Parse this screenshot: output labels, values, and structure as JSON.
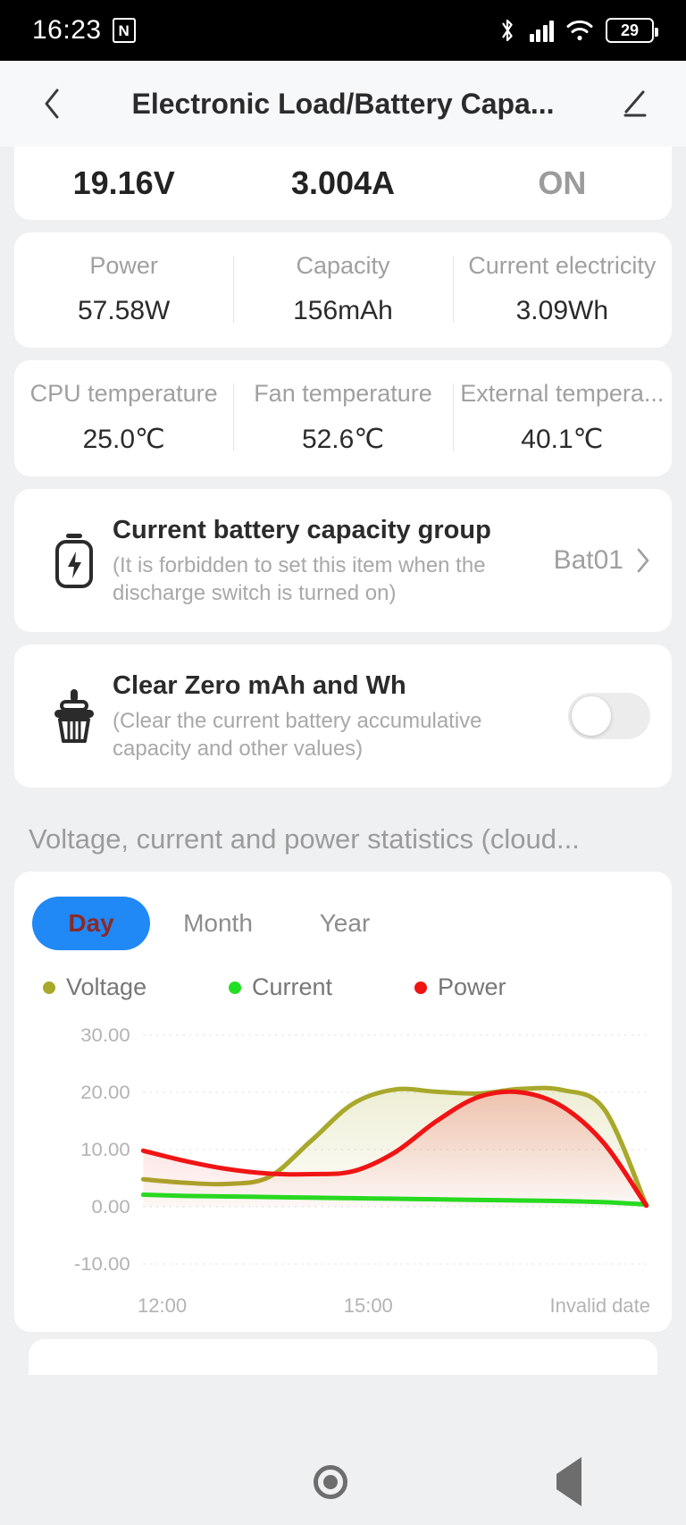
{
  "status_bar": {
    "time": "16:23",
    "nfc_glyph": "N",
    "battery_percent": "29",
    "icons": [
      "nfc-icon",
      "bluetooth-icon",
      "cellular-signal-icon",
      "wifi-icon",
      "battery-icon"
    ]
  },
  "app_bar": {
    "title": "Electronic Load/Battery Capa...",
    "back_icon": "chevron-left-icon",
    "edit_icon": "pencil-icon"
  },
  "readout": {
    "voltage": "19.16V",
    "current": "3.004A",
    "state": "ON"
  },
  "metrics_primary": [
    {
      "label": "Power",
      "value": "57.58W"
    },
    {
      "label": "Capacity",
      "value": "156mAh"
    },
    {
      "label": "Current electricity",
      "value": "3.09Wh"
    }
  ],
  "metrics_temperature": [
    {
      "label": "CPU temperature",
      "value": "25.0℃"
    },
    {
      "label": "Fan temperature",
      "value": "52.6℃"
    },
    {
      "label": "External tempera...",
      "value": "40.1℃"
    }
  ],
  "battery_group_setting": {
    "icon": "battery-bolt-icon",
    "title": "Current battery capacity group",
    "hint": "(It is forbidden to set this item when the discharge switch is turned on)",
    "value": "Bat01",
    "chevron": "chevron-right-icon"
  },
  "clear_zero_setting": {
    "icon": "broom-icon",
    "title": "Clear Zero mAh and Wh",
    "hint": "(Clear the current battery accumulative capacity and other values)",
    "toggle_state": "off"
  },
  "chart_section": {
    "title": "Voltage, current and power statistics (cloud...",
    "tabs": [
      {
        "label": "Day",
        "active": true
      },
      {
        "label": "Month",
        "active": false
      },
      {
        "label": "Year",
        "active": false
      }
    ]
  },
  "colors": {
    "accent_blue": "#2089f5",
    "voltage": "#a8a82b",
    "current": "#21e021",
    "power": "#f01414",
    "tab_active_text": "#8a2a28"
  },
  "chart_data": {
    "type": "line",
    "title": "Voltage, current and power statistics (cloud...",
    "xlabel": "",
    "ylabel": "",
    "ylim": [
      -10,
      30
    ],
    "yticks": [
      "-10.00",
      "0.00",
      "10.00",
      "20.00",
      "30.00"
    ],
    "xticks": [
      "12:00",
      "15:00",
      "Invalid date"
    ],
    "grid": true,
    "legend_position": "top",
    "x": [
      0,
      1,
      2,
      3,
      4,
      5,
      6,
      7,
      8,
      9,
      10,
      11,
      12
    ],
    "series": [
      {
        "name": "Voltage",
        "color": "#a8a82b",
        "values": [
          4.8,
          4.2,
          4.0,
          5.2,
          11.5,
          18.0,
          20.5,
          20.1,
          19.8,
          20.6,
          20.4,
          17.0,
          0.2
        ]
      },
      {
        "name": "Current",
        "color": "#21e021",
        "values": [
          2.1,
          1.9,
          1.8,
          1.7,
          1.6,
          1.5,
          1.4,
          1.3,
          1.2,
          1.1,
          1.0,
          0.8,
          0.4
        ]
      },
      {
        "name": "Power",
        "color": "#f01414",
        "values": [
          9.8,
          8.0,
          6.6,
          5.8,
          5.7,
          6.2,
          9.5,
          15.0,
          19.2,
          20.0,
          17.5,
          11.0,
          0.2
        ]
      }
    ]
  },
  "nav_bar": {
    "recents_icon": "square-icon",
    "home_icon": "circle-icon",
    "back_icon": "triangle-back-icon"
  }
}
